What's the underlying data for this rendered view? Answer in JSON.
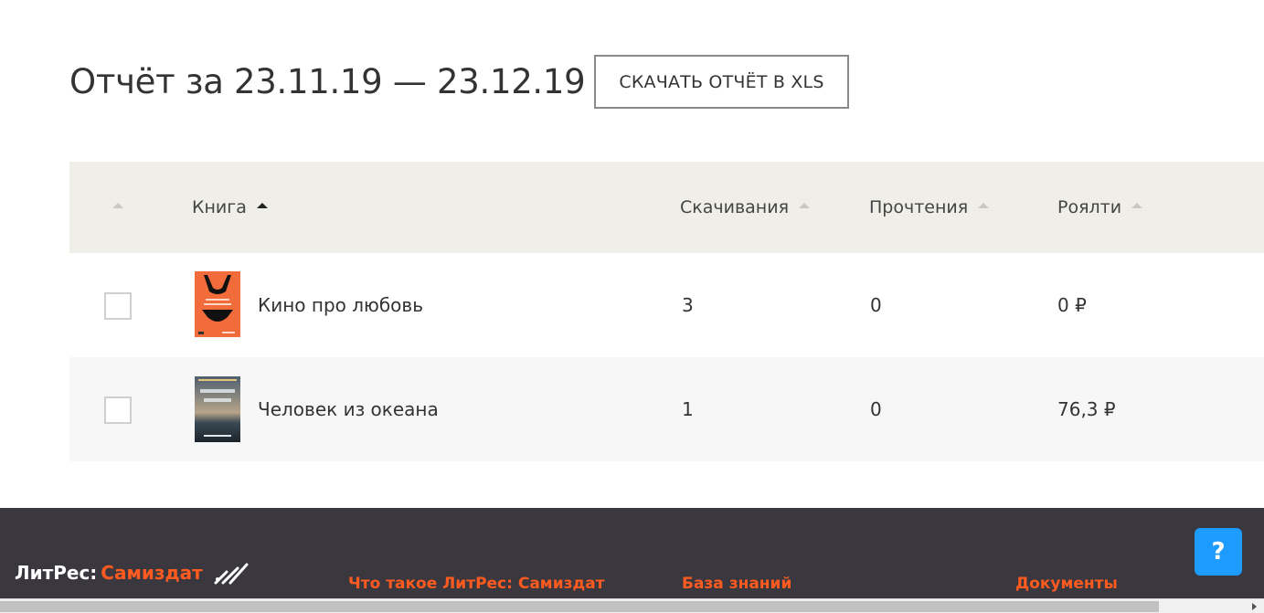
{
  "report": {
    "title": "Отчёт за 23.11.19 — 23.12.19",
    "download_label": "СКАЧАТЬ ОТЧЁТ В XLS"
  },
  "table": {
    "columns": [
      {
        "key": "select",
        "label": ""
      },
      {
        "key": "book",
        "label": "Книга",
        "sorted": true
      },
      {
        "key": "downloads",
        "label": "Скачивания"
      },
      {
        "key": "reads",
        "label": "Прочтения"
      },
      {
        "key": "royalty",
        "label": "Роялти"
      }
    ],
    "rows": [
      {
        "title": "Кино про любовь",
        "downloads": "3",
        "reads": "0",
        "royalty": "0 ₽",
        "cover_color": "#f26b3a"
      },
      {
        "title": "Человек из океана",
        "downloads": "1",
        "reads": "0",
        "royalty": "76,3 ₽",
        "cover_color": "#2f3a44"
      }
    ]
  },
  "footer": {
    "logo_part1": "ЛитРес:",
    "logo_part2": "Самиздат",
    "links": [
      "Что такое ЛитРес: Самиздат",
      "База знаний",
      "Документы"
    ]
  },
  "help": {
    "label": "?"
  },
  "colors": {
    "accent": "#ff5a1f",
    "help": "#1e9bff",
    "footer_bg": "#3a383e",
    "header_bg": "#efeee9"
  }
}
